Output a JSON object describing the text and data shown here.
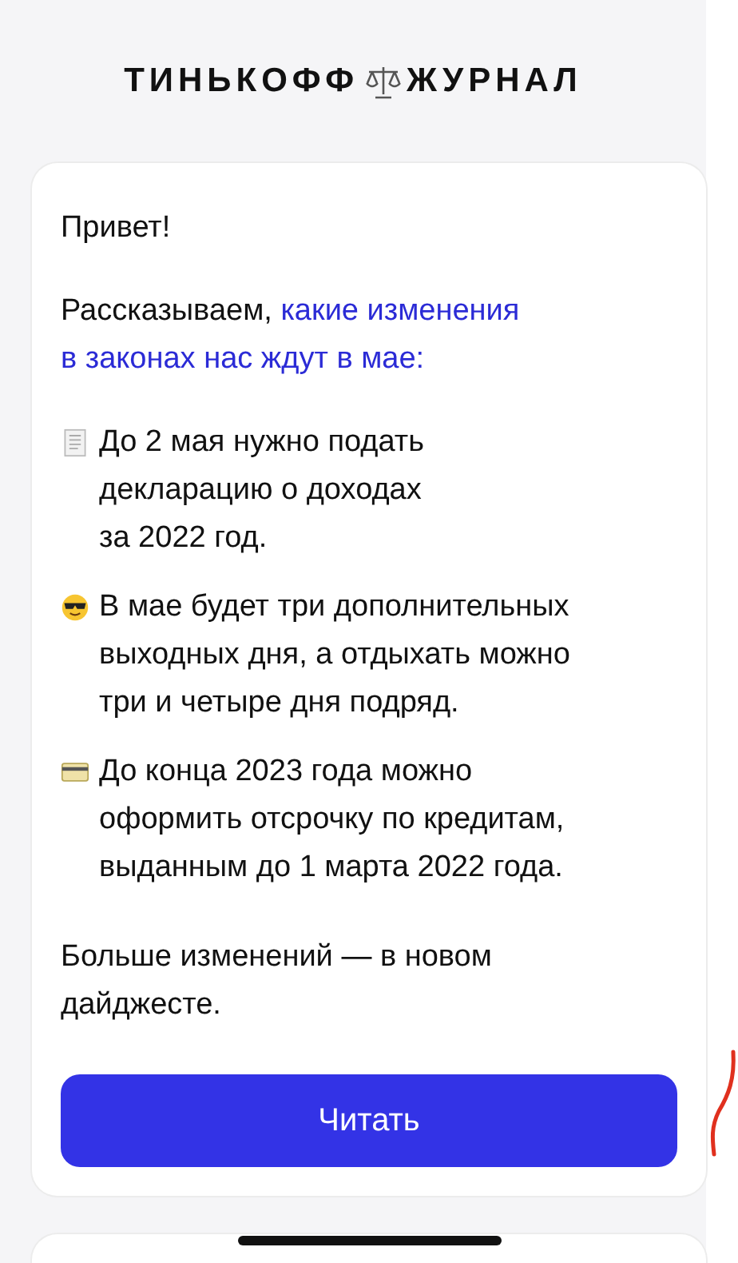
{
  "logo": {
    "left": "ТИНЬКОФФ",
    "right": "ЖУРНАЛ"
  },
  "greeting": "Привет!",
  "intro": {
    "text": "Рассказываем, ",
    "link": [
      "какие изменения",
      "в законах нас ждут в мае:"
    ]
  },
  "items": [
    {
      "kind": "document",
      "text": "До 2 мая нужно подать\nдекларацию о доходах\nза 2022 год."
    },
    {
      "kind": "sunglasses",
      "text": "В мае будет три дополнительных\nвыходных дня, а отдыхать можно\nтри и четыре дня подряд."
    },
    {
      "kind": "card",
      "text": "До конца 2023 года можно\nоформить отсрочку по кредитам,\nвыданным до 1 марта 2022 года."
    }
  ],
  "outro": "Больше изменений — в новом\nдайджесте.",
  "button": "Читать"
}
